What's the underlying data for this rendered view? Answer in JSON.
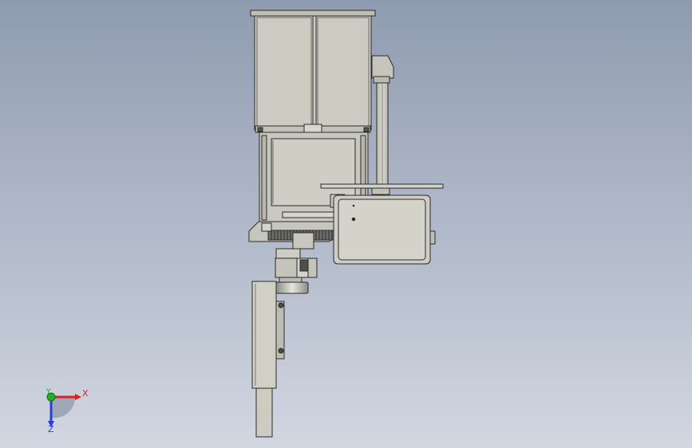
{
  "viewport": {
    "background_top": "#8f9bb0",
    "background_bottom": "#d2d7e1"
  },
  "model": {
    "part_fill": "#cccbc2",
    "part_fill_dark": "#b9b8af",
    "edge_color": "#2b2b2b",
    "hole_fill": "#4a4a4a"
  },
  "triad": {
    "x_label": "X",
    "y_label": "Y",
    "z_label": "Z",
    "x_color": "#e02020",
    "y_color": "#20b020",
    "z_color": "#2a3fd0"
  }
}
